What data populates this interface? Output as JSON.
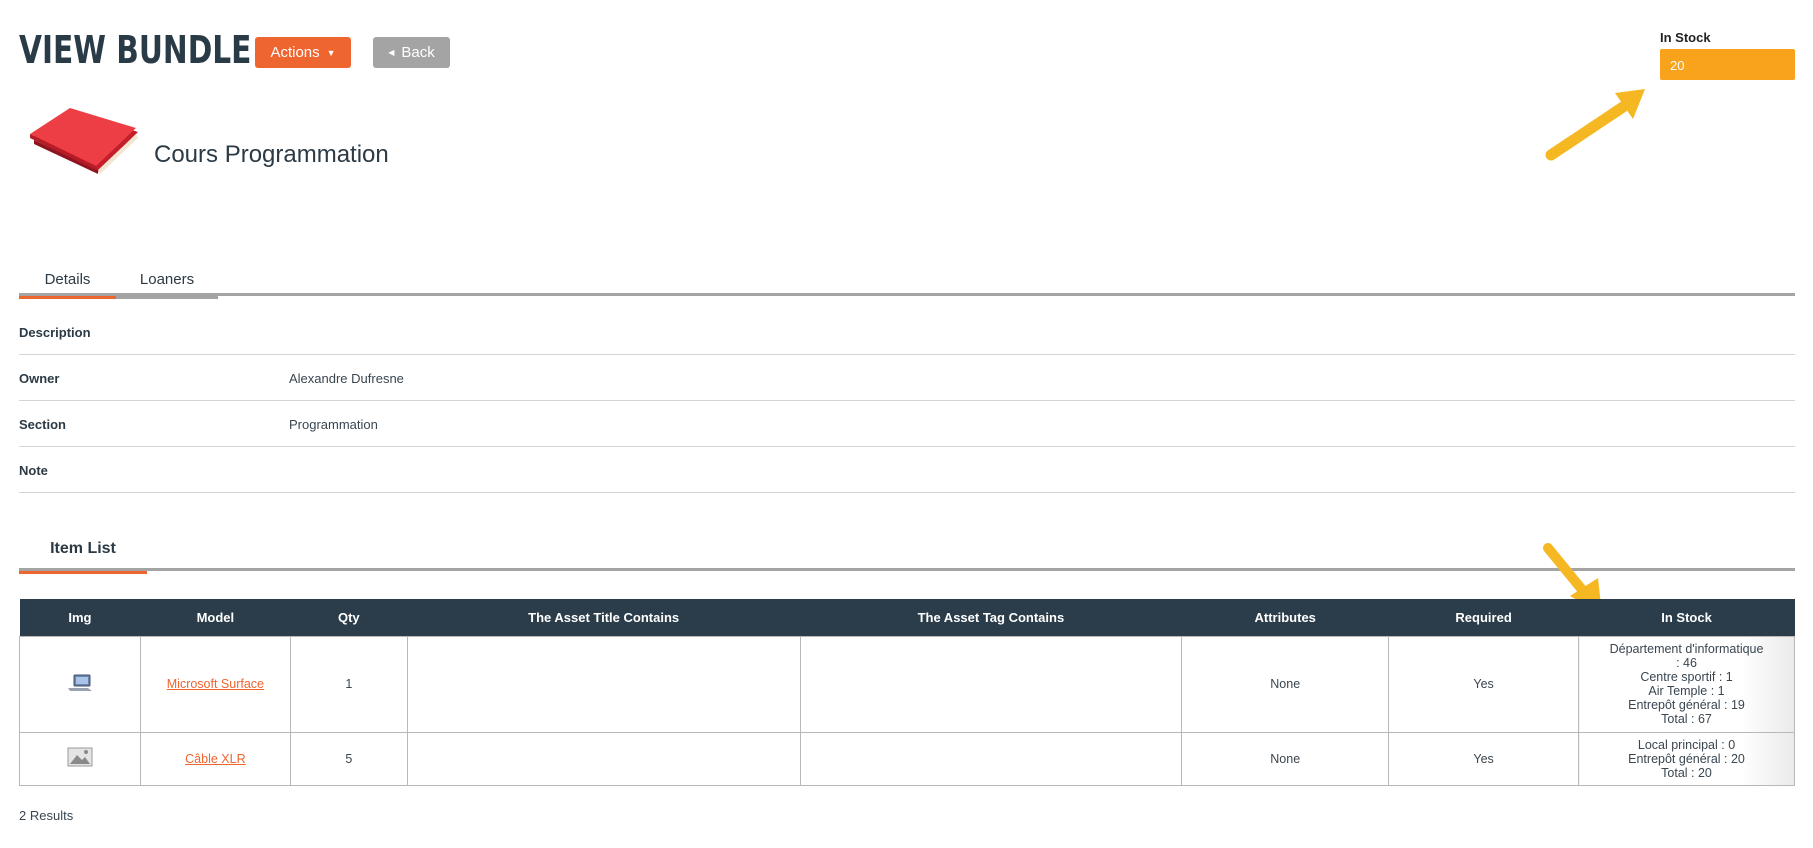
{
  "header": {
    "title": "VIEW BUNDLE",
    "actions_label": "Actions",
    "back_label": "Back"
  },
  "stock": {
    "label": "In Stock",
    "value": "20"
  },
  "bundle": {
    "name": "Cours Programmation",
    "icon": "book-icon"
  },
  "tabs": [
    {
      "label": "Details",
      "active": true
    },
    {
      "label": "Loaners",
      "active": false
    }
  ],
  "details": [
    {
      "label": "Description",
      "value": ""
    },
    {
      "label": "Owner",
      "value": "Alexandre Dufresne"
    },
    {
      "label": "Section",
      "value": "Programmation"
    },
    {
      "label": "Note",
      "value": ""
    }
  ],
  "item_list": {
    "title": "Item List",
    "columns": [
      "Img",
      "Model",
      "Qty",
      "The Asset Title Contains",
      "The Asset Tag Contains",
      "Attributes",
      "Required",
      "In Stock"
    ],
    "rows": [
      {
        "img": "laptop-icon",
        "model": "Microsoft Surface",
        "qty": "1",
        "title_contains": "",
        "tag_contains": "",
        "attributes": "None",
        "required": "Yes",
        "stock_lines": [
          "Département d'informatique",
          ": 46",
          "Centre sportif : 1",
          "Air Temple : 1",
          "Entrepôt général : 19",
          "Total : 67"
        ]
      },
      {
        "img": "image-placeholder-icon",
        "model": "Câble XLR",
        "qty": "5",
        "title_contains": "",
        "tag_contains": "",
        "attributes": "None",
        "required": "Yes",
        "stock_lines": [
          "Local principal : 0",
          "Entrepôt général : 20",
          "Total : 20"
        ]
      }
    ]
  },
  "results": "2 Results",
  "colors": {
    "accent": "#ee6530",
    "stock_box": "#f9a21b",
    "table_header": "#2b3d4a",
    "annotation_arrow": "#f5b823"
  }
}
